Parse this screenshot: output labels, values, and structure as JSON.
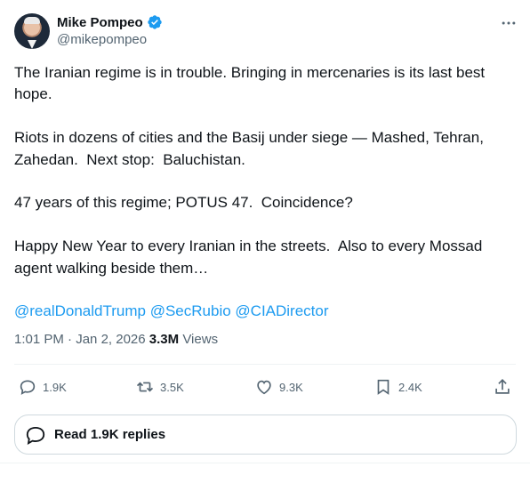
{
  "author": {
    "name": "Mike Pompeo",
    "handle": "@mikepompeo",
    "verified_color": "#1d9bf0"
  },
  "tweet": {
    "paragraphs": [
      "The Iranian regime is in trouble. Bringing in mercenaries is its last best hope.",
      "Riots in dozens of cities and the Basij under siege — Mashed, Tehran, Zahedan.  Next stop:  Baluchistan.",
      "47 years of this regime; POTUS 47.  Coincidence?",
      "Happy New Year to every Iranian in the streets.  Also to every Mossad agent walking beside them…"
    ],
    "mentions": [
      "@realDonaldTrump",
      "@SecRubio",
      "@CIADirector"
    ]
  },
  "meta": {
    "time": "1:01 PM",
    "separator": " · ",
    "date": "Jan 2, 2026",
    "views_count": "3.3M",
    "views_label": "Views"
  },
  "actions": {
    "reply_count": "1.9K",
    "retweet_count": "3.5K",
    "like_count": "9.3K",
    "bookmark_count": "2.4K"
  },
  "read_replies_label": "Read 1.9K replies",
  "icons": {
    "verified": "verified-badge-icon",
    "more": "more-horizontal-icon",
    "reply": "reply-bubble-icon",
    "retweet": "retweet-icon",
    "like": "heart-icon",
    "bookmark": "bookmark-icon",
    "share": "share-icon"
  },
  "colors": {
    "text": "#0f1419",
    "secondary": "#536471",
    "link": "#1d9bf0",
    "border": "#cfd9de"
  }
}
